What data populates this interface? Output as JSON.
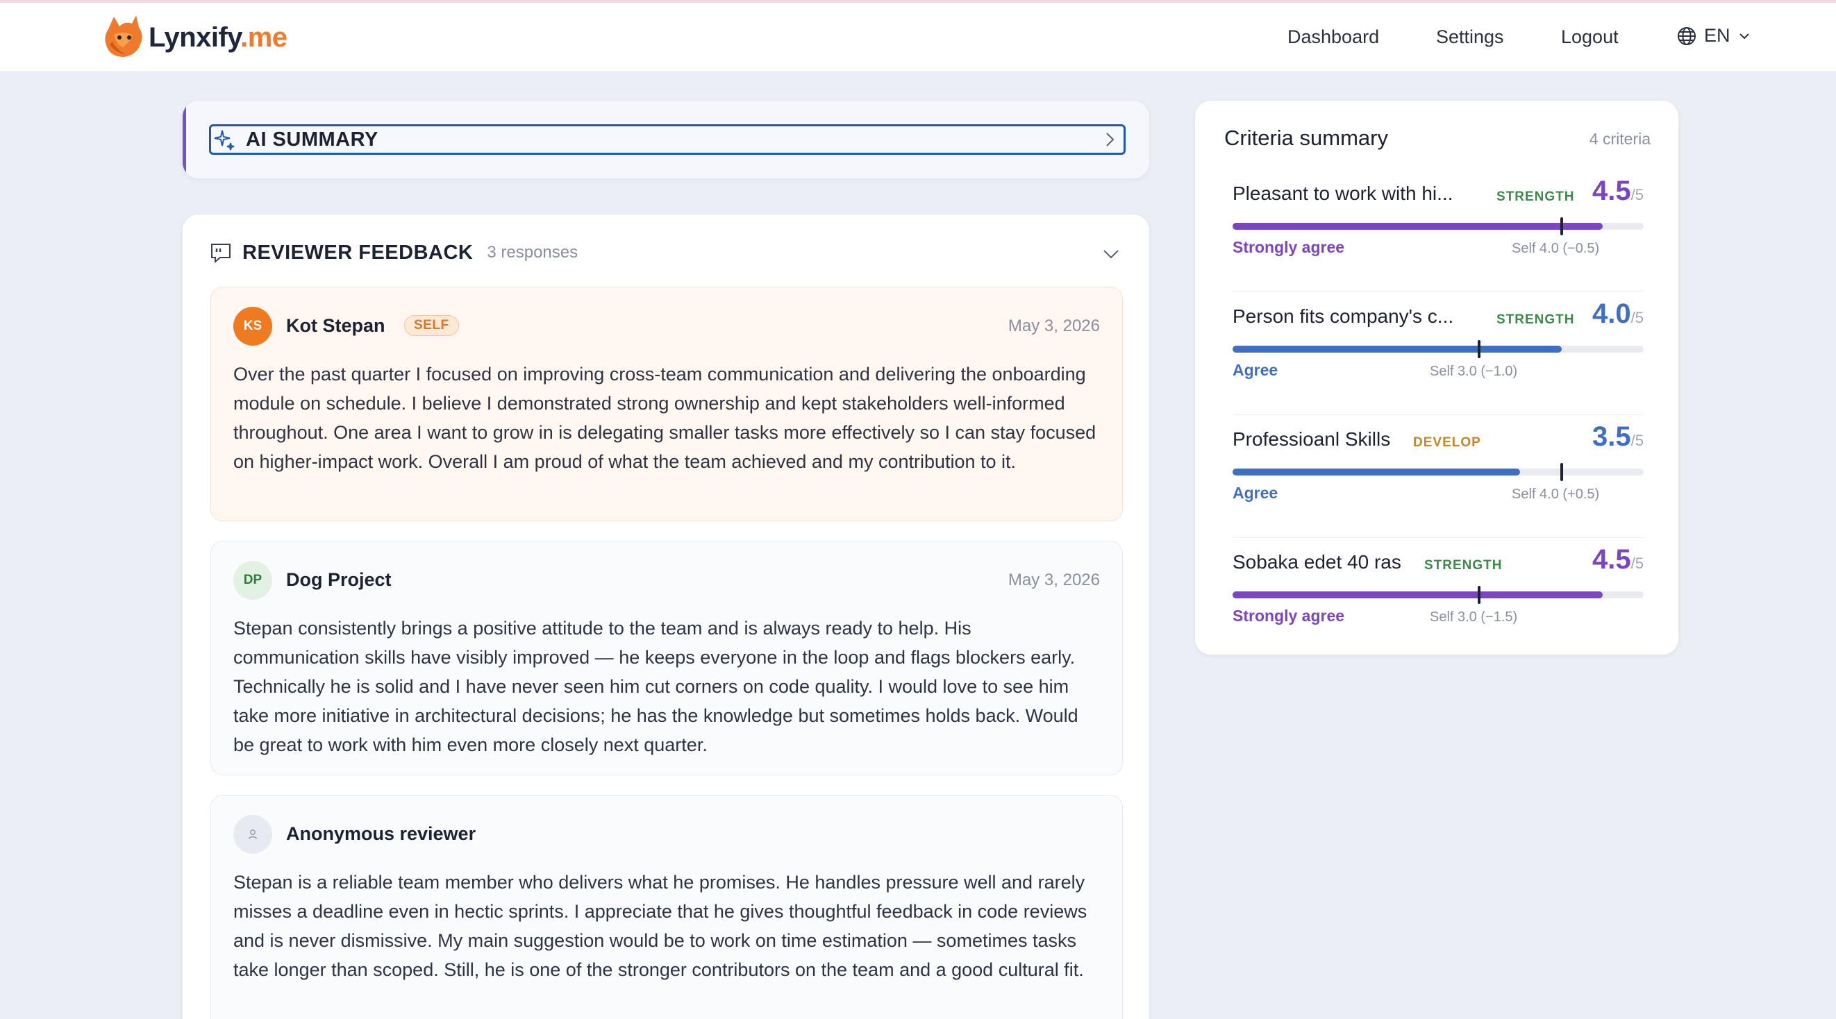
{
  "header": {
    "logo_text_main": "Lynxify",
    "logo_text_accent": ".me",
    "nav": [
      "Dashboard",
      "Settings",
      "Logout"
    ],
    "language": "EN"
  },
  "ai_summary": {
    "title": "AI SUMMARY"
  },
  "feedback": {
    "title": "REVIEWER FEEDBACK",
    "count": "3 responses",
    "reviews": [
      {
        "initials": "KS",
        "name": "Kot Stepan",
        "badge": "SELF",
        "date": "May 3, 2026",
        "text": "Over the past quarter I focused on improving cross-team communication and delivering the onboarding module on schedule. I believe I demonstrated strong ownership and kept stakeholders well-informed throughout. One area I want to grow in is delegating smaller tasks more effectively so I can stay focused on higher-impact work. Overall I am proud of what the team achieved and my contribution to it."
      },
      {
        "initials": "DP",
        "name": "Dog Project",
        "date": "May 3, 2026",
        "text": "Stepan consistently brings a positive attitude to the team and is always ready to help. His communication skills have visibly improved — he keeps everyone in the loop and flags blockers early. Technically he is solid and I have never seen him cut corners on code quality. I would love to see him take more initiative in architectural decisions; he has the knowledge but sometimes holds back. Would be great to work with him even more closely next quarter."
      },
      {
        "name": "Anonymous reviewer",
        "text": "Stepan is a reliable team member who delivers what he promises. He handles pressure well and rarely misses a deadline even in hectic sprints. I appreciate that he gives thoughtful feedback in code reviews and is never dismissive. My main suggestion would be to work on time estimation — sometimes tasks take longer than scoped. Still, he is one of the stronger contributors on the team and a good cultural fit."
      }
    ]
  },
  "criteria": {
    "title": "Criteria summary",
    "count": "4 criteria",
    "items": [
      {
        "name": "Pleasant to work with hi...",
        "tag": "STRENGTH",
        "score": "4.5",
        "denom": "/5",
        "score_value": 4.5,
        "self_value": 4.0,
        "label": "Strongly agree",
        "self_text": "Self 4.0 (−0.5)",
        "color": "#7b45c2"
      },
      {
        "name": "Person fits company's c...",
        "tag": "STRENGTH",
        "score": "4.0",
        "denom": "/5",
        "score_value": 4.0,
        "self_value": 3.0,
        "label": "Agree",
        "self_text": "Self 3.0 (−1.0)",
        "color": "#3f6fc4"
      },
      {
        "name": "Professioanl Skills",
        "tag": "DEVELOP",
        "score": "3.5",
        "denom": "/5",
        "score_value": 3.5,
        "self_value": 4.0,
        "label": "Agree",
        "self_text": "Self 4.0 (+0.5)",
        "color": "#3f6fc4"
      },
      {
        "name": "Sobaka edet 40 ras",
        "tag": "STRENGTH",
        "score": "4.5",
        "denom": "/5",
        "score_value": 4.5,
        "self_value": 3.0,
        "label": "Strongly agree",
        "self_text": "Self 3.0 (−1.5)",
        "color": "#7b45c2"
      }
    ]
  },
  "colors": {
    "accent_orange": "#f07a2c",
    "accent_purple": "#7b45c2",
    "accent_blue": "#3f6fc4",
    "focus_blue": "#1f5ba8"
  }
}
